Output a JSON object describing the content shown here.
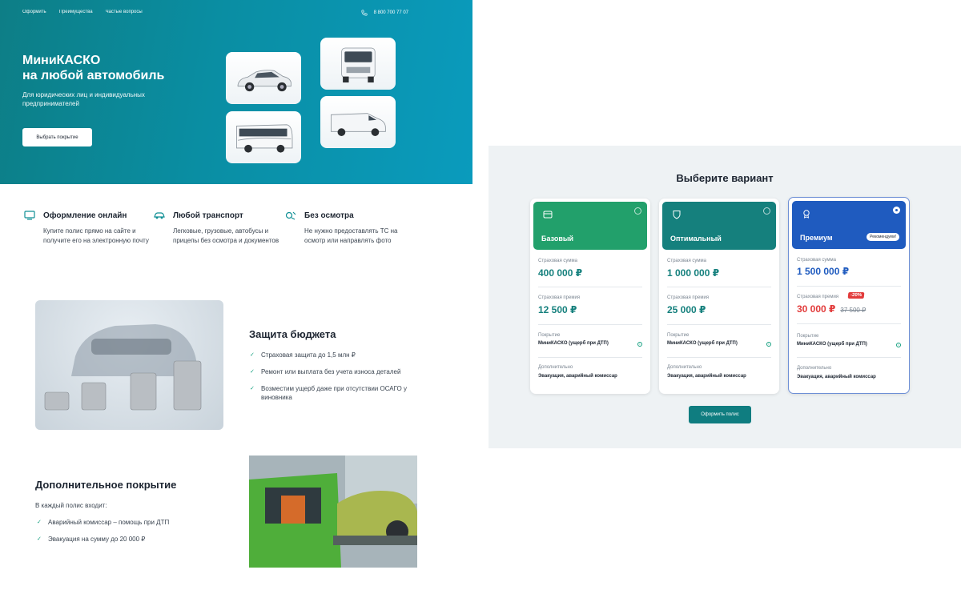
{
  "nav": {
    "items": [
      "Оформить",
      "Преимущества",
      "Частые вопросы"
    ],
    "phone": "8 800 700 77 07"
  },
  "hero": {
    "title_line1": "МиниКАСКО",
    "title_line2": "на любой автомобиль",
    "subtitle": "Для юридических лиц и индивидуальных предпринимателей",
    "button": "Выбрать покрытие"
  },
  "features": [
    {
      "title": "Оформление онлайн",
      "text": "Купите полис прямо на сайте и получите его на электронную почту",
      "icon": "monitor-icon"
    },
    {
      "title": "Любой транспорт",
      "text": "Легковые, грузовые, автобусы и прицепы без осмотра и документов",
      "icon": "car-icon"
    },
    {
      "title": "Без осмотра",
      "text": "Не нужно предоставлять ТС на осмотр или направлять фото",
      "icon": "no-inspection-icon"
    }
  ],
  "budget": {
    "title": "Защита бюджета",
    "items": [
      "Страховая защита до 1,5 млн ₽",
      "Ремонт или выплата без учета износа деталей",
      "Возместим ущерб даже при отсутствии ОСАГО у виновника"
    ]
  },
  "extra": {
    "title": "Дополнительное покрытие",
    "intro": "В каждый полис входит:",
    "items": [
      "Аварийный комиссар – помощь при ДТП",
      "Эвакуация на сумму до 20 000 ₽"
    ]
  },
  "plans": {
    "title": "Выберите вариант",
    "cta": "Оформить полис",
    "labels": {
      "sum": "Страховая сумма",
      "premium": "Страховая премия",
      "coverage": "Покрытие",
      "additional": "Дополнительно"
    },
    "cards": [
      {
        "name": "Базовый",
        "sum": "400 000 ₽",
        "premium": "12 500 ₽",
        "coverage": "МиниКАСКО (ущерб при ДТП)",
        "additional": "Эвакуация, аварийный комиссар",
        "color": "#22a06b"
      },
      {
        "name": "Оптимальный",
        "sum": "1 000 000 ₽",
        "premium": "25 000 ₽",
        "coverage": "МиниКАСКО (ущерб при ДТП)",
        "additional": "Эвакуация, аварийный комиссар",
        "color": "#15807d"
      },
      {
        "name": "Премиум",
        "badge": "Рекомендуем!",
        "sum": "1 500 000 ₽",
        "premium": "30 000 ₽",
        "old_premium": "37 500 ₽",
        "discount": "-20%",
        "coverage": "МиниКАСКО (ущерб при ДТП)",
        "additional": "Эвакуация, аварийный комиссар",
        "color": "#1f5bbf"
      }
    ]
  }
}
